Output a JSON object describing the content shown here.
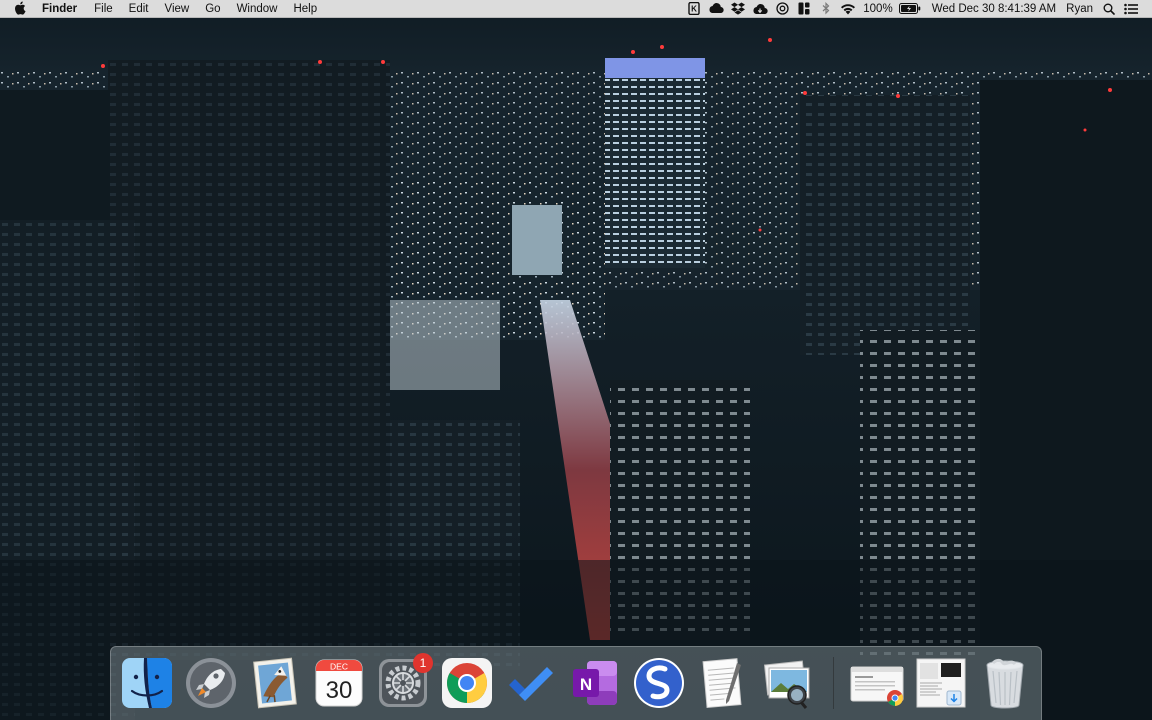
{
  "menubar": {
    "app_name": "Finder",
    "menus": [
      "File",
      "Edit",
      "View",
      "Go",
      "Window",
      "Help"
    ],
    "status": {
      "battery_percent": "100%",
      "datetime": "Wed Dec 30  8:41:39 AM",
      "user": "Ryan"
    },
    "status_icons": [
      "kindle-icon",
      "cloud-icon",
      "dropbox-icon",
      "creative-cloud-icon",
      "target-icon",
      "split-view-icon",
      "bluetooth-icon",
      "wifi-icon",
      "battery-icon",
      "spotlight-search-icon",
      "notification-center-icon"
    ]
  },
  "dock": {
    "apps": [
      {
        "name": "Finder",
        "icon": "finder-icon",
        "running": true
      },
      {
        "name": "Launchpad",
        "icon": "launchpad-icon",
        "running": false
      },
      {
        "name": "Mail",
        "icon": "mail-icon",
        "running": false
      },
      {
        "name": "Calendar",
        "icon": "calendar-icon",
        "running": true,
        "month": "DEC",
        "day": "30"
      },
      {
        "name": "System Preferences",
        "icon": "system-preferences-icon",
        "running": true,
        "badge": "1"
      },
      {
        "name": "Google Chrome",
        "icon": "chrome-icon",
        "running": true
      },
      {
        "name": "Microsoft To Do",
        "icon": "todo-icon",
        "running": true
      },
      {
        "name": "OneNote",
        "icon": "onenote-icon",
        "running": false
      },
      {
        "name": "Simplenote",
        "icon": "simplenote-icon",
        "running": false
      },
      {
        "name": "TextEdit",
        "icon": "textedit-icon",
        "running": true
      },
      {
        "name": "Preview",
        "icon": "preview-icon",
        "running": true
      }
    ],
    "others": [
      {
        "name": "Chrome window",
        "icon": "minimized-chrome-window-icon"
      },
      {
        "name": "Downloads",
        "icon": "downloads-stack-icon"
      },
      {
        "name": "Trash",
        "icon": "trash-icon"
      }
    ]
  },
  "colors": {
    "menubar_bg": "#dcdcdc",
    "sky": "#101c24",
    "badge_red": "#e0342e"
  }
}
